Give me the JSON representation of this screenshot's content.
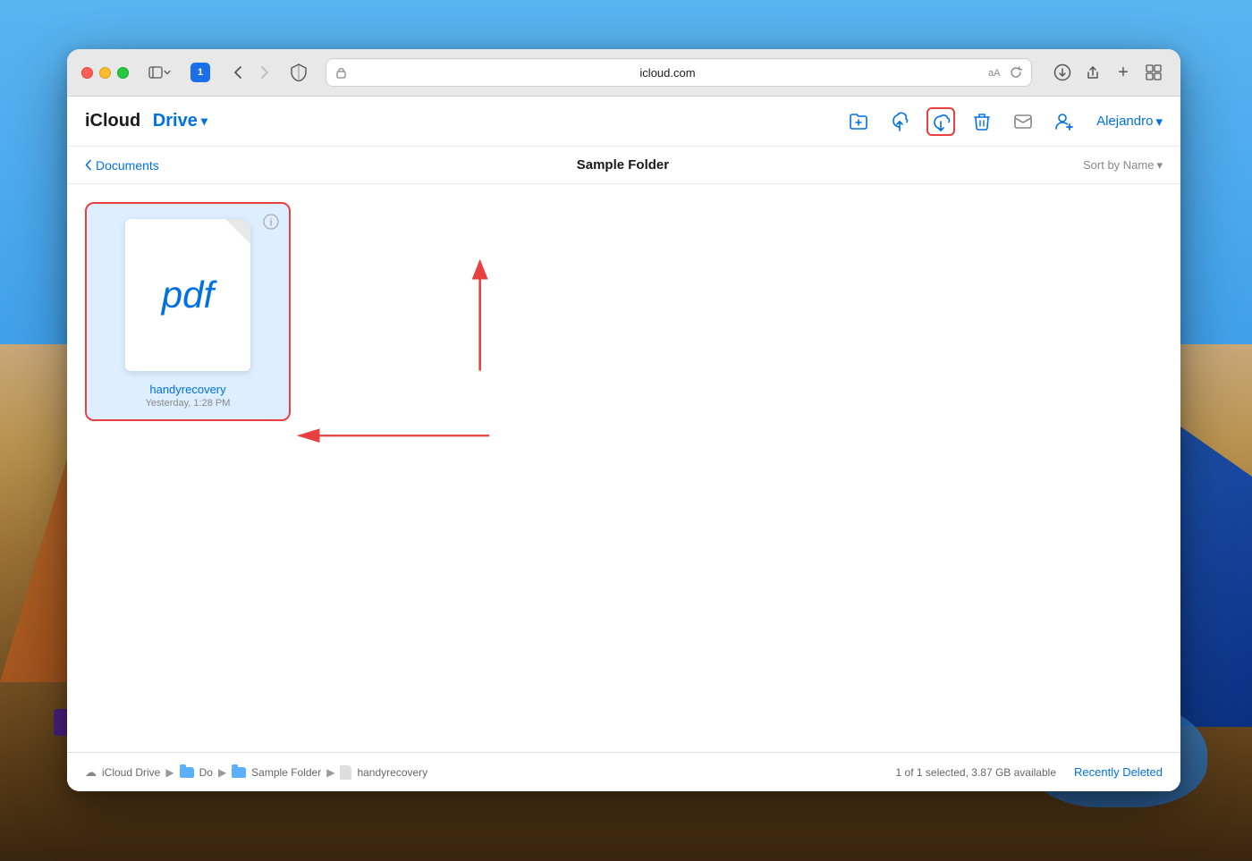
{
  "desktop": {
    "bg_description": "macOS desktop with canyon/landscape wallpaper"
  },
  "browser": {
    "url": "icloud.com",
    "url_display": "icloud.com",
    "back_enabled": true,
    "forward_enabled": false
  },
  "app": {
    "title_icloud": "iCloud",
    "title_drive": "Drive",
    "title_chevron": "▾",
    "user_name": "Alejandro",
    "user_chevron": "▾"
  },
  "toolbar": {
    "new_folder_label": "New Folder",
    "upload_label": "Upload",
    "download_label": "Download",
    "delete_label": "Delete",
    "email_label": "Share via Mail",
    "add_person_label": "Add Person"
  },
  "nav": {
    "back_label": "Documents",
    "current_folder": "Sample Folder",
    "sort_label": "Sort by Name",
    "sort_chevron": "▾"
  },
  "files": [
    {
      "name": "handyrecovery",
      "type": "pdf",
      "date": "Yesterday, 1:28 PM",
      "selected": true
    }
  ],
  "status_bar": {
    "breadcrumb_items": [
      {
        "label": "iCloud Drive",
        "type": "cloud"
      },
      {
        "label": "Do",
        "type": "folder"
      },
      {
        "label": "Sample Folder",
        "type": "folder"
      },
      {
        "label": "handyrecovery",
        "type": "file"
      }
    ],
    "selection_info": "1 of 1 selected, 3.87 GB available",
    "recently_deleted": "Recently Deleted"
  },
  "annotations": {
    "arrow1_label": "Download button highlighted",
    "arrow2_label": "PDF file highlighted"
  }
}
